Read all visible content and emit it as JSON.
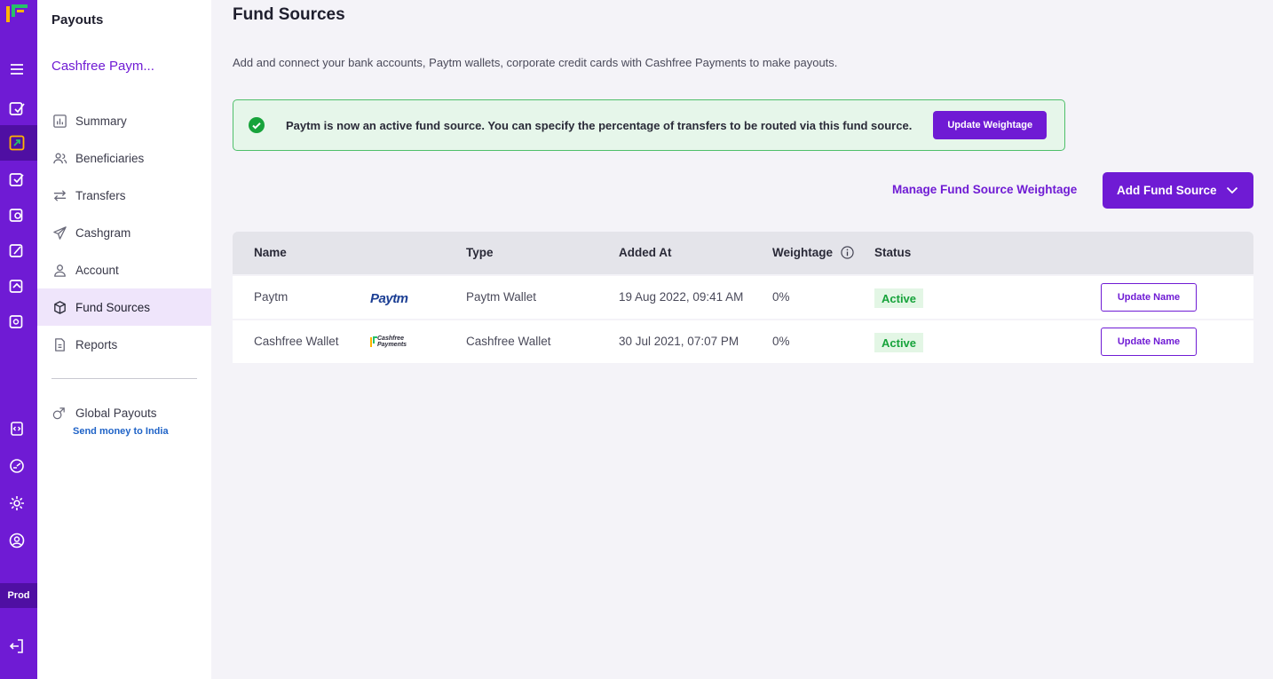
{
  "colors": {
    "brand": "#6f1bd4",
    "success": "#17a33b",
    "link": "#1f63c7"
  },
  "rail": {
    "env_label": "Prod",
    "icons": [
      "menu-icon",
      "payment-gateway-icon",
      "payouts-icon",
      "product-icon",
      "product-icon",
      "product-icon",
      "product-icon",
      "product-icon",
      "developers-icon",
      "analytics-icon",
      "settings-icon",
      "profile-icon",
      "logout-icon"
    ]
  },
  "sidenav": {
    "title": "Payouts",
    "merchant": "Cashfree Paym...",
    "items": [
      {
        "label": "Summary",
        "icon": "bar-chart-icon"
      },
      {
        "label": "Beneficiaries",
        "icon": "users-icon"
      },
      {
        "label": "Transfers",
        "icon": "transfer-arrows-icon"
      },
      {
        "label": "Cashgram",
        "icon": "paper-plane-icon"
      },
      {
        "label": "Account",
        "icon": "user-icon"
      },
      {
        "label": "Fund Sources",
        "icon": "box-icon",
        "active": true
      },
      {
        "label": "Reports",
        "icon": "document-icon"
      }
    ],
    "global": {
      "label": "Global Payouts",
      "sub": "Send money to India",
      "icon": "globe-transfer-icon"
    }
  },
  "page": {
    "title": "Fund Sources",
    "description": "Add and connect your bank accounts, Paytm wallets, corporate credit cards with Cashfree Payments to make payouts.",
    "banner": {
      "message": "Paytm is now an active fund source. You can specify the percentage of transfers to be routed via this fund source.",
      "button": "Update Weightage"
    },
    "manage_link": "Manage Fund Source Weightage",
    "add_button": "Add Fund Source"
  },
  "table": {
    "columns": [
      "Name",
      "Type",
      "Added At",
      "Weightage",
      "Status"
    ],
    "rows": [
      {
        "name": "Paytm",
        "logo": "paytm-logo",
        "logo_text": "Paytm",
        "type": "Paytm Wallet",
        "added_at": "19 Aug 2022, 09:41 AM",
        "weightage": "0%",
        "status": "Active",
        "action": "Update Name"
      },
      {
        "name": "Cashfree Wallet",
        "logo": "cashfree-logo",
        "logo_text_1": "Cashfree",
        "logo_text_2": "Payments",
        "type": "Cashfree Wallet",
        "added_at": "30 Jul 2021, 07:07 PM",
        "weightage": "0%",
        "status": "Active",
        "action": "Update Name"
      }
    ]
  }
}
